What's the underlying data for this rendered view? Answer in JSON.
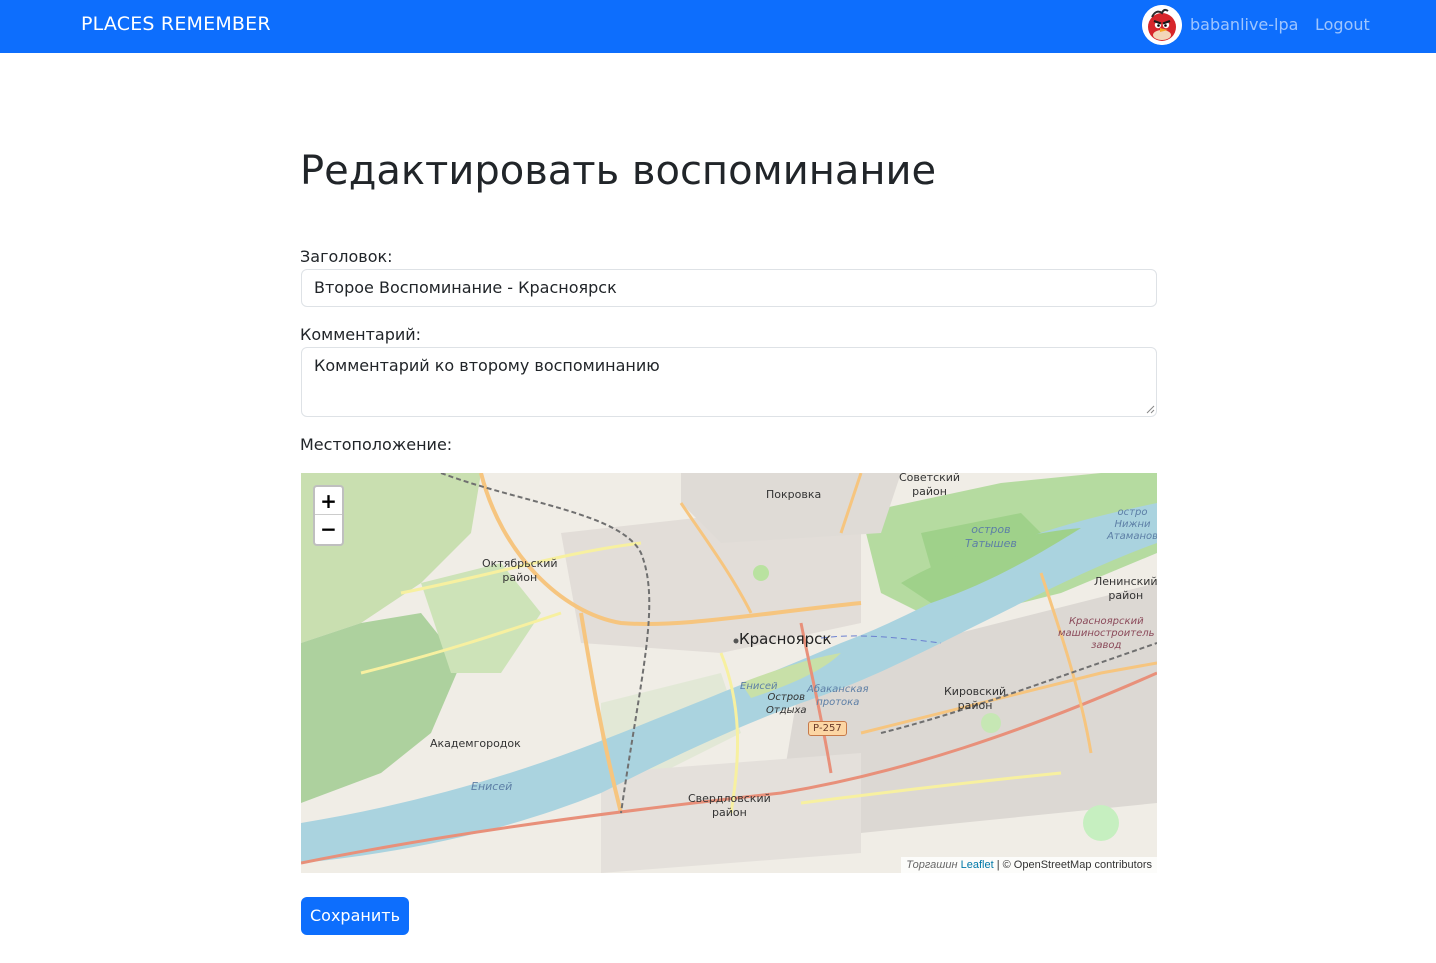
{
  "navbar": {
    "brand": "PLACES REMEMBER",
    "username": "babanlive-lpa",
    "logout_label": "Logout"
  },
  "page": {
    "title": "Редактировать воспоминание"
  },
  "form": {
    "title_label": "Заголовок:",
    "title_value": "Второе Воспоминание - Красноярск",
    "comment_label": "Комментарий:",
    "comment_value": "Комментарий ко второму воспоминанию",
    "location_label": "Местоположение:",
    "save_label": "Сохранить"
  },
  "map": {
    "zoom_in": "+",
    "zoom_out": "−",
    "attribution_leaflet": "Leaflet",
    "attribution_separator": " | © OpenStreetMap contributors",
    "attribution_left": "Торгашин",
    "route_shield": "Р-257",
    "places": {
      "sovetsky": "Советский\nрайон",
      "pokrovka": "Покровка",
      "ostrov_tatyshev": "остров\nТатышев",
      "ostrov_nizhny": "остро\nНижни\nАтаманов",
      "oktyabrsky": "Октябрьский\nрайон",
      "leninsky": "Ленинский\nрайон",
      "krasnoyarsk": "Красноярск",
      "kmz": "Красноярский\nмашиностроитель\nзавод",
      "enisei1": "Енисей",
      "ostrov_otdykha": "Остров\nОтдыха",
      "abakanskaya": "Абаканская\nпротока",
      "kirovsky": "Кировский\nрайон",
      "akademgorodok": "Академгородок",
      "enisei2": "Енисей",
      "sverdlovsky": "Свердловский\nрайон"
    }
  }
}
